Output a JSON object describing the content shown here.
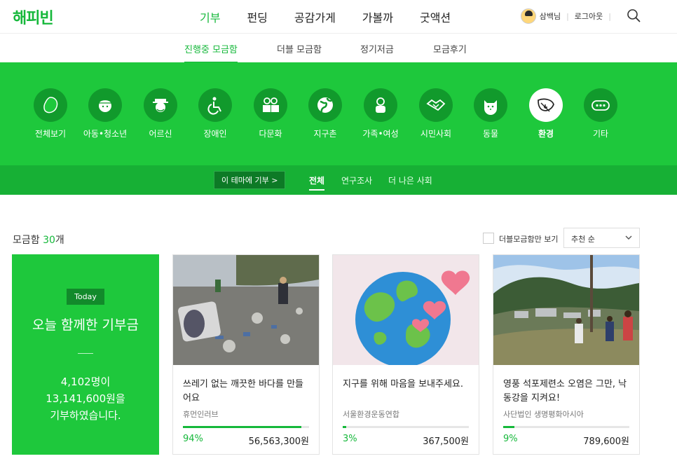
{
  "header": {
    "logo": "해피빈",
    "nav": [
      "기부",
      "펀딩",
      "공감가게",
      "가볼까",
      "굿액션"
    ],
    "user_name": "삼백님",
    "logout": "로그아웃"
  },
  "subnav": [
    "진행중 모금함",
    "더블 모금함",
    "정기저금",
    "모금후기"
  ],
  "categories": [
    {
      "label": "전체보기",
      "icon": "bean-icon"
    },
    {
      "label": "아동•청소년",
      "icon": "child-icon"
    },
    {
      "label": "어르신",
      "icon": "elder-icon"
    },
    {
      "label": "장애인",
      "icon": "wheelchair-icon"
    },
    {
      "label": "다문화",
      "icon": "people-icon"
    },
    {
      "label": "지구촌",
      "icon": "globe-icon"
    },
    {
      "label": "가족•여성",
      "icon": "family-icon"
    },
    {
      "label": "시민사회",
      "icon": "handshake-icon"
    },
    {
      "label": "동물",
      "icon": "animal-icon"
    },
    {
      "label": "환경",
      "icon": "leaf-icon"
    },
    {
      "label": "기타",
      "icon": "more-icon"
    }
  ],
  "theme_button": "이 테마에 기부 >",
  "filters": [
    "전체",
    "연구조사",
    "더 나은 사회"
  ],
  "list": {
    "count_prefix": "모금함",
    "count_num": "30",
    "count_suffix": "개",
    "double_only": "더블모금함만 보기",
    "sort": "추천 순"
  },
  "today": {
    "tag": "Today",
    "title": "오늘 함께한 기부금",
    "line1": "4,102명이",
    "line2": "13,141,600원을",
    "line3": "기부하였습니다."
  },
  "cards": [
    {
      "title": "쓰레기 없는 깨끗한 바다를 만들어요",
      "org": "휴먼인러브",
      "progress": 94,
      "percent": "94%",
      "amount": "56,563,300원"
    },
    {
      "title": "지구를 위해 마음을 보내주세요.",
      "org": "서울환경운동연합",
      "progress": 3,
      "percent": "3%",
      "amount": "367,500원"
    },
    {
      "title": "영풍 석포제련소 오염은 그만, 낙동강을 지켜요!",
      "org": "사단법인 생명평화아시아",
      "progress": 9,
      "percent": "9%",
      "amount": "789,600원"
    }
  ],
  "colors": {
    "brand": "#16b83b",
    "band": "#1ec83c",
    "band_dark": "#17b035"
  }
}
